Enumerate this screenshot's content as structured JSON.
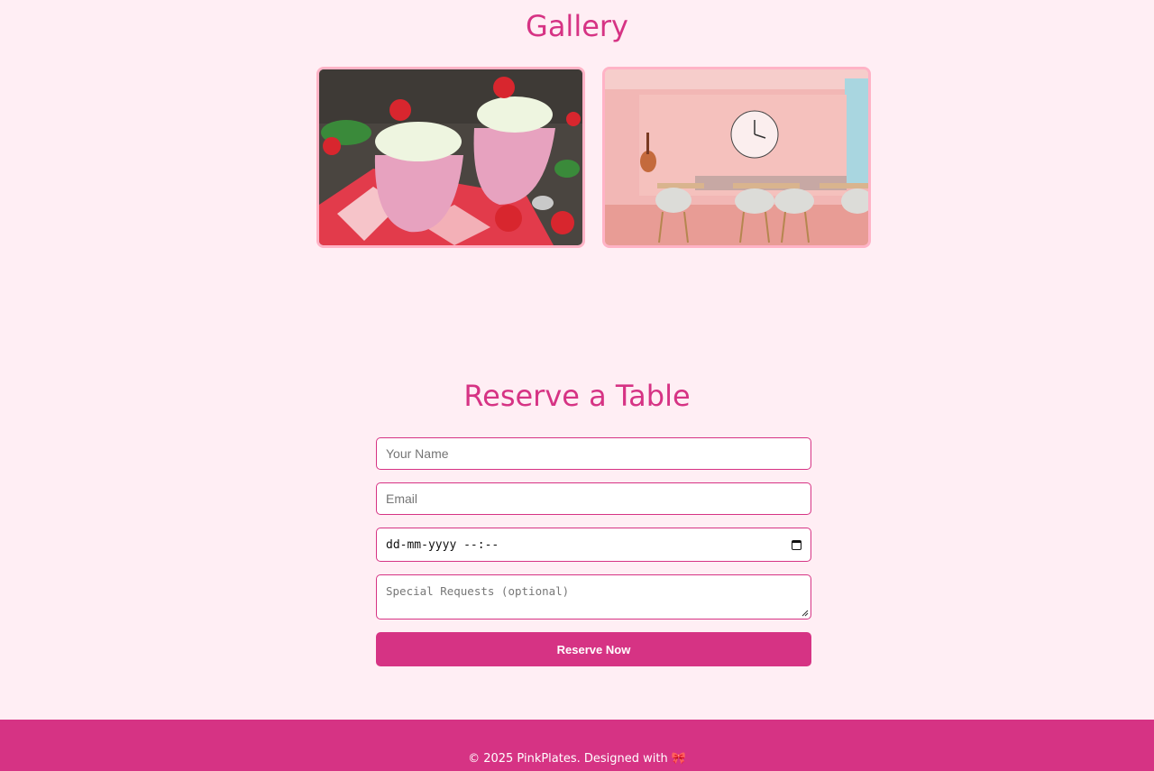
{
  "gallery": {
    "title": "Gallery",
    "images": [
      {
        "name": "strawberry-dessert-image"
      },
      {
        "name": "pink-dining-room-image"
      }
    ]
  },
  "reservation": {
    "title": "Reserve a Table",
    "name_placeholder": "Your Name",
    "email_placeholder": "Email",
    "datetime_placeholder": "dd-mm-yyyy --:--",
    "requests_placeholder": "Special Requests (optional)",
    "submit_label": "Reserve Now"
  },
  "footer": {
    "text": "© 2025 PinkPlates. Designed with",
    "heart": "🎀"
  },
  "colors": {
    "background": "#ffeef4",
    "accent": "#d63384",
    "image_border": "#ffb3c6"
  }
}
